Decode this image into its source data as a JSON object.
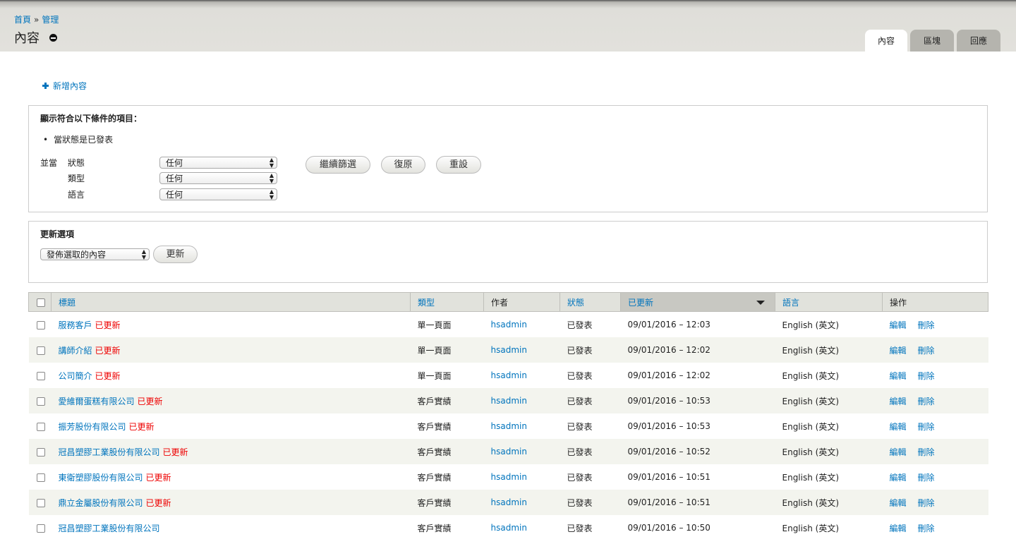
{
  "breadcrumb": {
    "home": "首頁",
    "sep": "»",
    "admin": "管理"
  },
  "page_title": "內容",
  "tabs": {
    "content": "內容",
    "blocks": "區塊",
    "comments": "回應"
  },
  "add_content": "新增內容",
  "filter": {
    "title": "顯示符合以下條件的項目：",
    "current": "當狀態是已發表",
    "and_label": "並當",
    "status_label": "狀態",
    "type_label": "類型",
    "lang_label": "語言",
    "status_value": "任何",
    "type_value": "任何",
    "lang_value": "任何",
    "refine": "繼續篩選",
    "undo": "復原",
    "reset": "重設"
  },
  "update": {
    "title": "更新選項",
    "action_value": "發佈選取的內容",
    "button": "更新"
  },
  "table": {
    "headers": {
      "title": "標題",
      "type": "類型",
      "author": "作者",
      "status": "狀態",
      "updated": "已更新",
      "language": "語言",
      "ops": "操作"
    },
    "updated_mark": "已更新",
    "edit": "編輯",
    "delete": "刪除",
    "rows": [
      {
        "title": "服務客戶",
        "flag": "已更新",
        "type": "單一頁面",
        "author": "hsadmin",
        "status": "已發表",
        "updated": "09/01/2016 – 12:03",
        "language": "English (英文)"
      },
      {
        "title": "講師介紹",
        "flag": "已更新",
        "type": "單一頁面",
        "author": "hsadmin",
        "status": "已發表",
        "updated": "09/01/2016 – 12:02",
        "language": "English (英文)"
      },
      {
        "title": "公司簡介",
        "flag": "已更新",
        "type": "單一頁面",
        "author": "hsadmin",
        "status": "已發表",
        "updated": "09/01/2016 – 12:02",
        "language": "English (英文)"
      },
      {
        "title": "愛維爾蛋糕有限公司",
        "flag": "已更新",
        "type": "客戶實績",
        "author": "hsadmin",
        "status": "已發表",
        "updated": "09/01/2016 – 10:53",
        "language": "English (英文)"
      },
      {
        "title": "振芳股份有限公司",
        "flag": "已更新",
        "type": "客戶實績",
        "author": "hsadmin",
        "status": "已發表",
        "updated": "09/01/2016 – 10:53",
        "language": "English (英文)"
      },
      {
        "title": "冠昌塑膠工業股份有限公司",
        "flag": "已更新",
        "type": "客戶實績",
        "author": "hsadmin",
        "status": "已發表",
        "updated": "09/01/2016 – 10:52",
        "language": "English (英文)"
      },
      {
        "title": "東衛塑膠股份有限公司",
        "flag": "已更新",
        "type": "客戶實績",
        "author": "hsadmin",
        "status": "已發表",
        "updated": "09/01/2016 – 10:51",
        "language": "English (英文)"
      },
      {
        "title": "鼎立金屬股份有限公司",
        "flag": "已更新",
        "type": "客戶實績",
        "author": "hsadmin",
        "status": "已發表",
        "updated": "09/01/2016 – 10:51",
        "language": "English (英文)"
      },
      {
        "title": "冠昌塑膠工業股份有限公司",
        "flag": "",
        "type": "客戶實績",
        "author": "hsadmin",
        "status": "已發表",
        "updated": "09/01/2016 – 10:50",
        "language": "English (英文)"
      }
    ]
  }
}
